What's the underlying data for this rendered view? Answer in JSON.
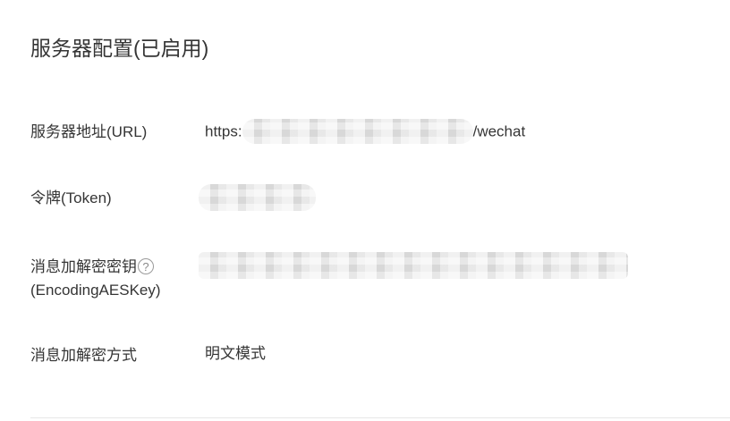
{
  "section": {
    "title": "服务器配置(已启用)"
  },
  "rows": {
    "server_url": {
      "label": "服务器地址(URL)",
      "prefix": "https:",
      "suffix": "/wechat"
    },
    "token": {
      "label": "令牌(Token)"
    },
    "aes_key": {
      "label_line1": "消息加解密密钥",
      "label_line2": "(EncodingAESKey)",
      "help_glyph": "?",
      "help_icon_name": "question-circle-icon"
    },
    "encryption_mode": {
      "label": "消息加解密方式",
      "value": "明文模式"
    }
  },
  "colors": {
    "text": "#353535",
    "muted_icon": "#8a8a8a",
    "divider": "#e7e7e7",
    "redaction": "#e8e8e8"
  }
}
